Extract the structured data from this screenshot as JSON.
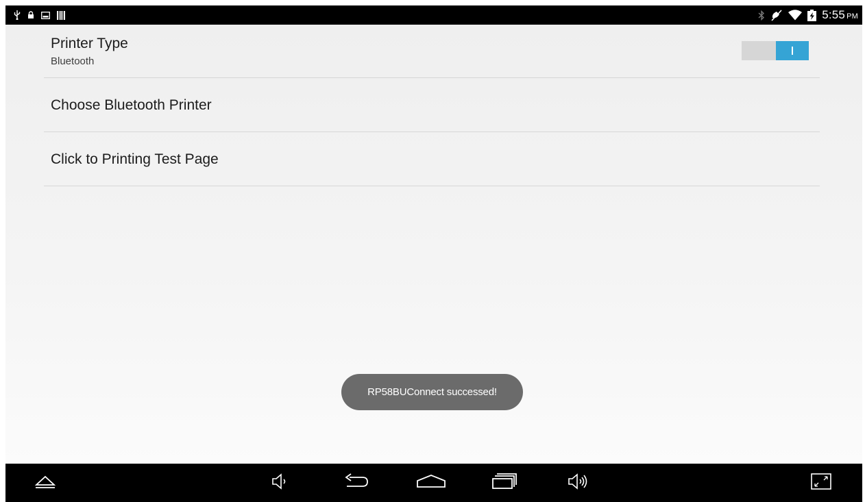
{
  "status_bar": {
    "left_icons": [
      "usb-icon",
      "lock-icon",
      "image-icon",
      "barcode-icon"
    ],
    "right_icons": [
      "bluetooth-icon",
      "mute-icon",
      "wifi-icon",
      "battery-charging-icon"
    ],
    "time": "5:55",
    "ampm": "PM"
  },
  "settings": {
    "printer_type": {
      "title": "Printer Type",
      "summary": "Bluetooth",
      "toggle_on": true
    },
    "choose_printer": {
      "title": "Choose Bluetooth Printer"
    },
    "test_page": {
      "title": "Click to Printing Test Page"
    }
  },
  "toast": {
    "message": "RP58BUConnect successed!"
  },
  "nav_bar": {
    "buttons": [
      "hide-bar-icon",
      "volume-down-icon",
      "back-icon",
      "home-icon",
      "recent-apps-icon",
      "volume-up-icon",
      "screen-toggle-icon"
    ]
  },
  "colors": {
    "accent": "#35a4d5",
    "toast_background": "#6b6b6b",
    "bars": "#000000"
  }
}
